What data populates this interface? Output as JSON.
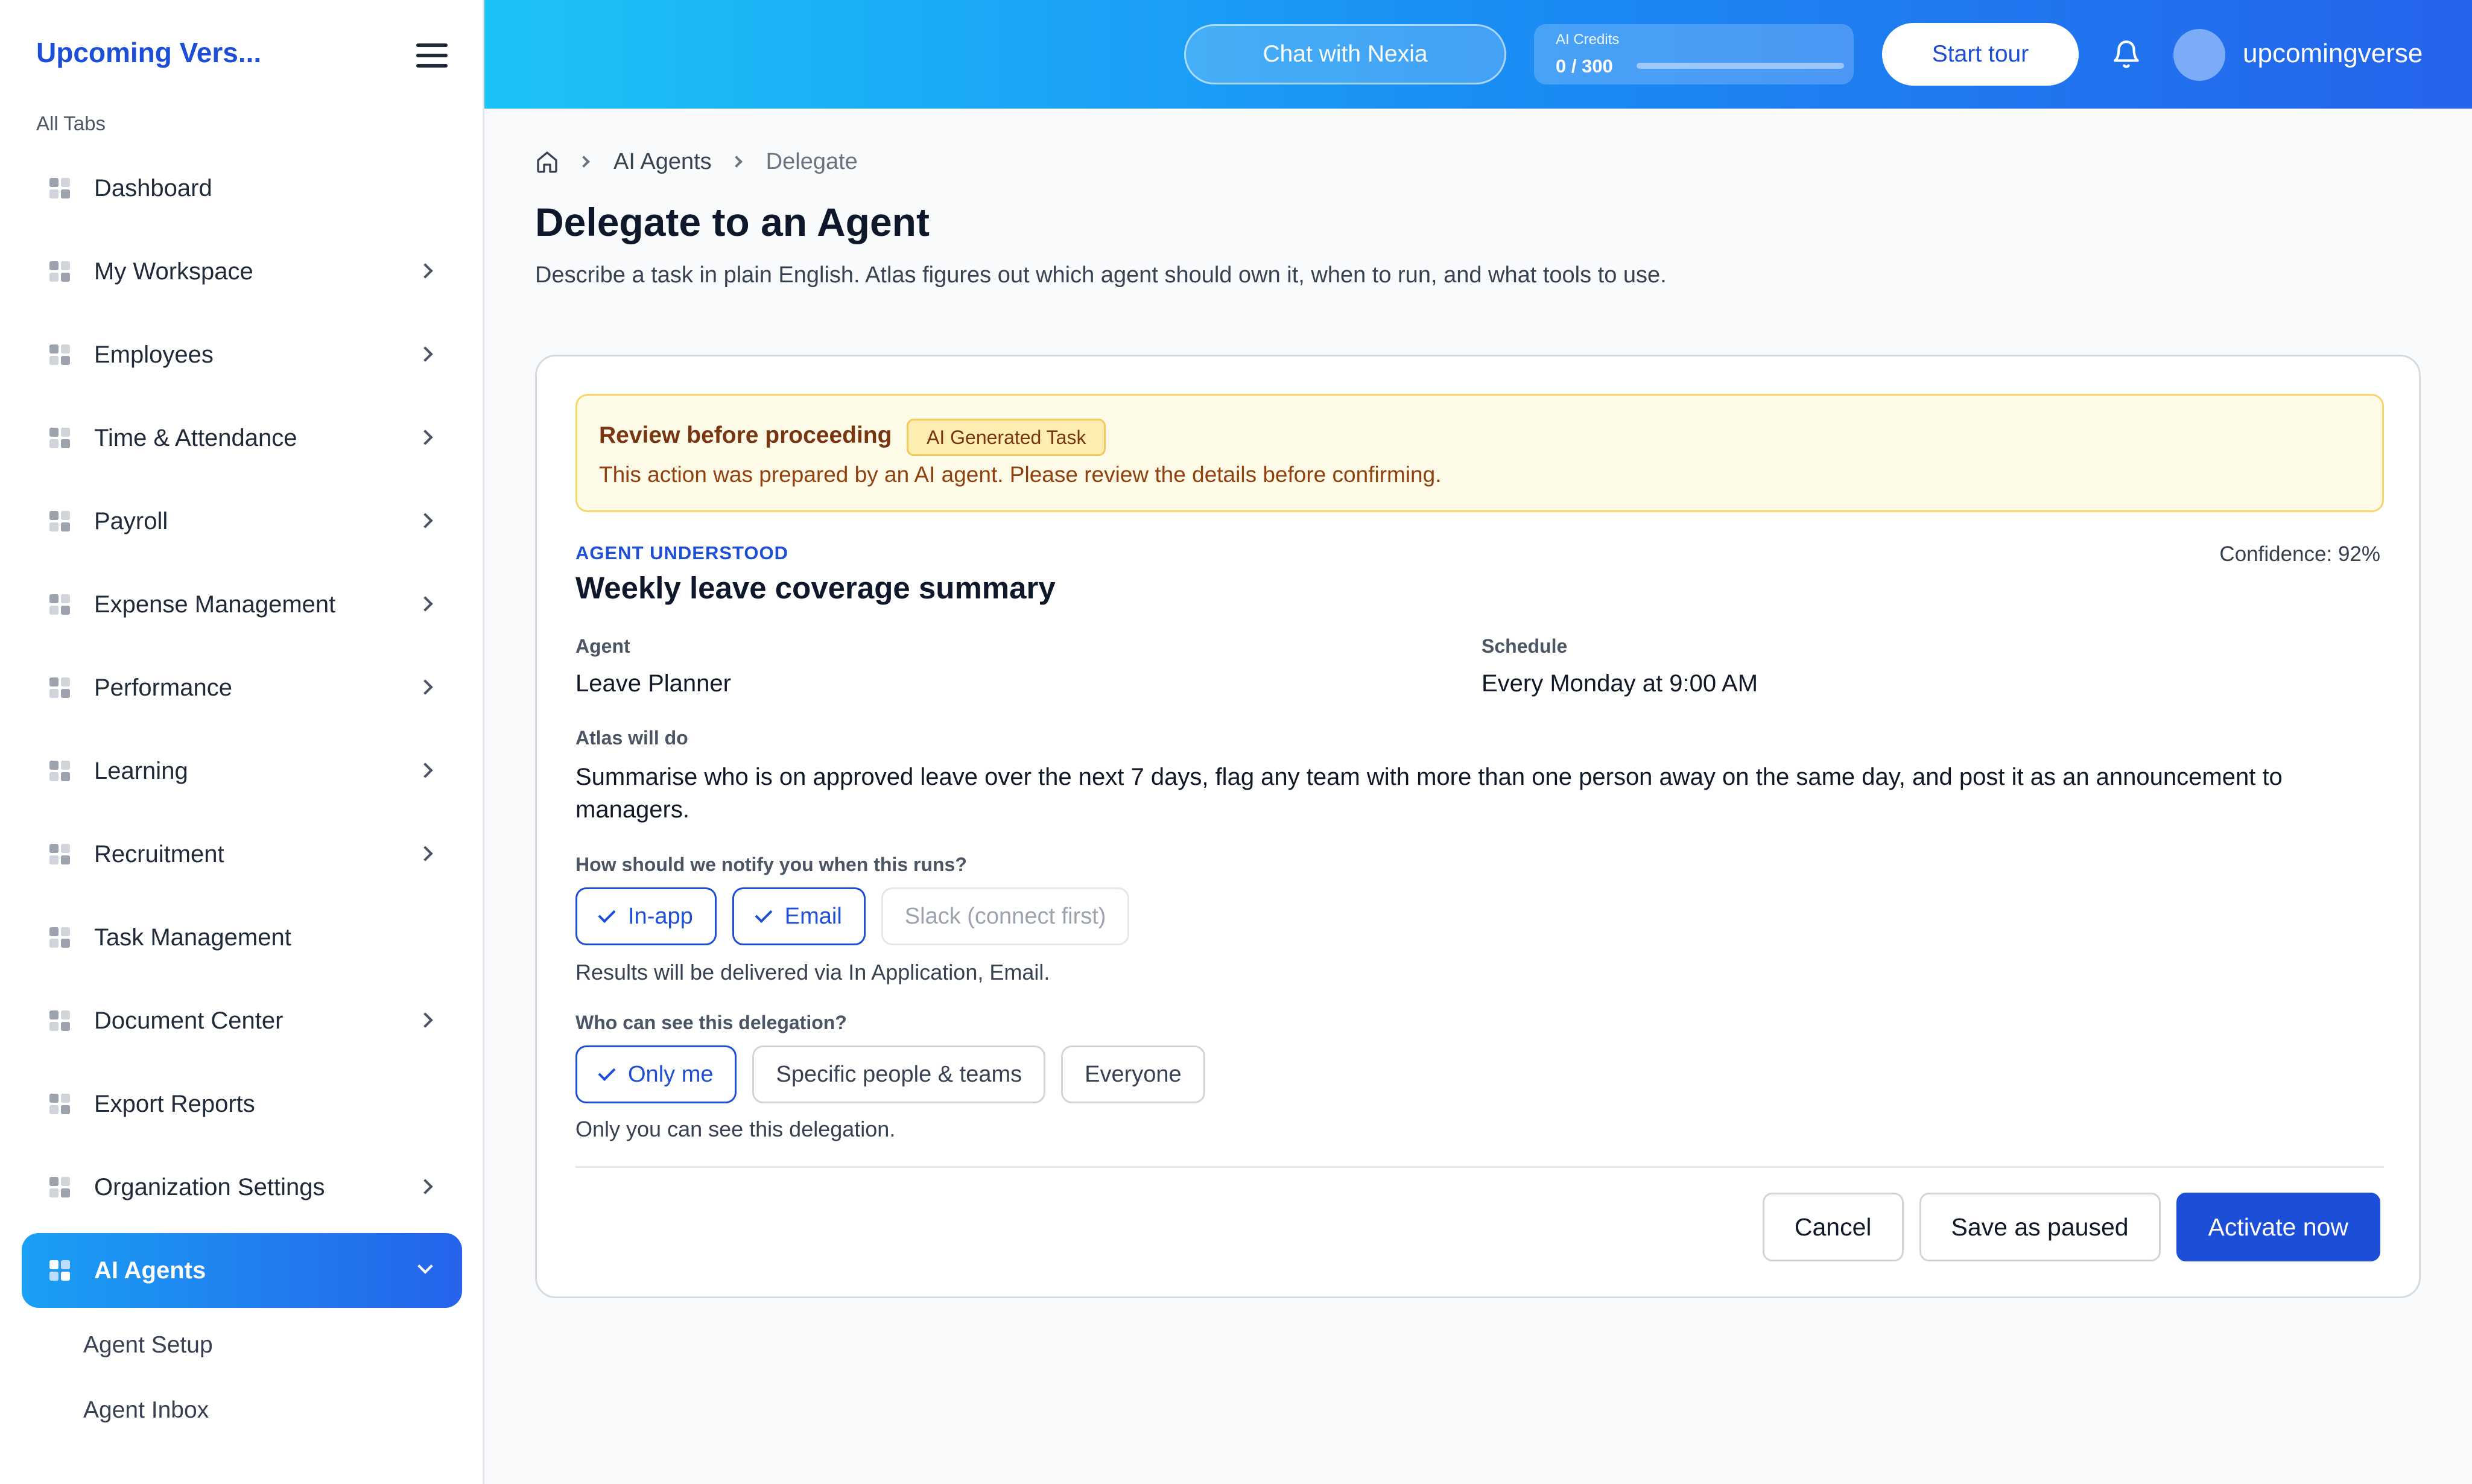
{
  "sidebar": {
    "brand": "Upcoming Vers...",
    "section_label": "All Tabs",
    "items": [
      {
        "label": "Dashboard"
      },
      {
        "label": "My Workspace"
      },
      {
        "label": "Employees"
      },
      {
        "label": "Time & Attendance"
      },
      {
        "label": "Payroll"
      },
      {
        "label": "Expense Management"
      },
      {
        "label": "Performance"
      },
      {
        "label": "Learning"
      },
      {
        "label": "Recruitment"
      },
      {
        "label": "Task Management"
      },
      {
        "label": "Document Center"
      },
      {
        "label": "Export Reports"
      },
      {
        "label": "Organization Settings"
      },
      {
        "label": "AI Agents"
      }
    ],
    "sub_items": [
      {
        "label": "Agent Setup"
      },
      {
        "label": "Agent Inbox"
      }
    ]
  },
  "topbar": {
    "chat_label": "Chat with Nexia",
    "credits_label": "AI Credits",
    "credits_value": "0 / 300",
    "credits_fraction": 0,
    "tour_label": "Start tour",
    "username": "upcomingverse"
  },
  "breadcrumb": {
    "items": [
      "AI Agents",
      "Delegate"
    ]
  },
  "page": {
    "title": "Delegate to an Agent",
    "description": "Describe a task in plain English. Atlas figures out which agent should own it, when to run, and what tools to use."
  },
  "review": {
    "title": "Review before proceeding",
    "badge": "AI Generated Task",
    "text": "This action was prepared by an AI agent. Please review the details before confirming."
  },
  "task": {
    "understood_label": "AGENT UNDERSTOOD",
    "confidence": "Confidence: 92%",
    "title": "Weekly leave coverage summary",
    "agent_label": "Agent",
    "agent_value": "Leave Planner",
    "schedule_label": "Schedule",
    "schedule_value": "Every Monday at 9:00 AM",
    "atlas_label": "Atlas will do",
    "atlas_text": "Summarise who is on approved leave over the next 7 days, flag any team with more than one person away on the same day, and post it as an announcement to managers."
  },
  "notify": {
    "question": "How should we notify you when this runs?",
    "options": [
      "In-app",
      "Email",
      "Slack (connect first)"
    ],
    "hint": "Results will be delivered via In Application, Email."
  },
  "visibility": {
    "question": "Who can see this delegation?",
    "options": [
      "Only me",
      "Specific people & teams",
      "Everyone"
    ],
    "hint": "Only you can see this delegation."
  },
  "actions": {
    "cancel": "Cancel",
    "save_paused": "Save as paused",
    "activate": "Activate now"
  },
  "colors": {
    "accent": "#1d4ed8",
    "topbar_start": "#1cc3f7",
    "topbar_end": "#2563eb",
    "warning_bg": "#fefae8",
    "warning_border": "#f6d66b"
  }
}
